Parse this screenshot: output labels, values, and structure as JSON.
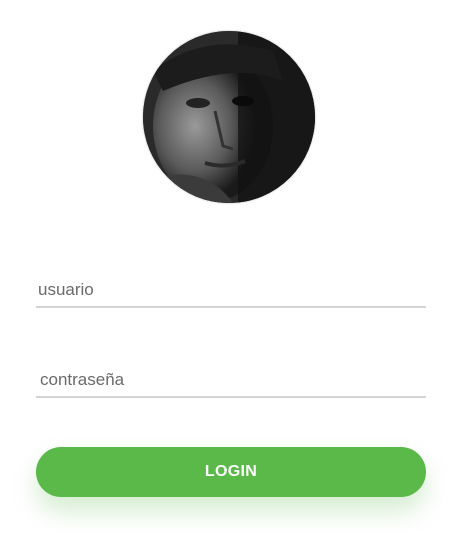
{
  "login_form": {
    "avatar_alt": "user-photo",
    "username": {
      "value": "",
      "placeholder": "usuario"
    },
    "password": {
      "value": "",
      "placeholder": "contraseña"
    },
    "login_label": "LOGIN",
    "accent_color": "#5bb94a"
  }
}
